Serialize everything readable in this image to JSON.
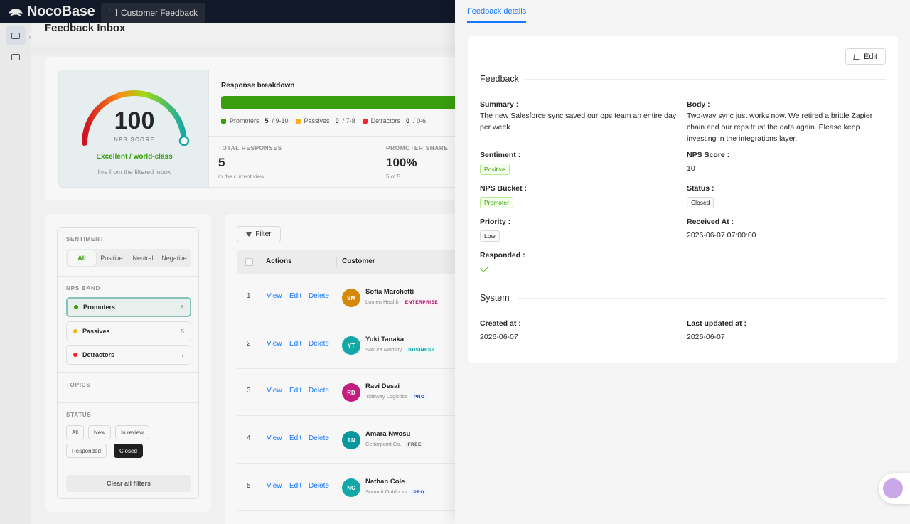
{
  "app": {
    "logo_text": "NocoBase",
    "tab_label": "Customer Feedback"
  },
  "page": {
    "title": "Feedback Inbox"
  },
  "nps": {
    "value": "100",
    "caption": "NPS SCORE",
    "grade": "Excellent / world-class",
    "note": "live from the filtered inbox",
    "gauge_fraction": 1.0
  },
  "breakdown": {
    "title": "Response breakdown",
    "legend": [
      {
        "label": "Promoters",
        "count": "5",
        "range": "/ 9-10",
        "color": "#389e0d"
      },
      {
        "label": "Passives",
        "count": "0",
        "range": "/ 7-8",
        "color": "#faad14"
      },
      {
        "label": "Detractors",
        "count": "0",
        "range": "/ 0-6",
        "color": "#f5222d"
      }
    ],
    "stats": [
      {
        "label": "TOTAL RESPONSES",
        "value": "5",
        "sub": "in the current view"
      },
      {
        "label": "PROMOTER SHARE",
        "value": "100%",
        "sub": "5 of 5"
      }
    ]
  },
  "filters": {
    "sentiment_label": "SENTIMENT",
    "sentiment": [
      "All",
      "Positive",
      "Neutral",
      "Negative"
    ],
    "nps_band_label": "NPS BAND",
    "bands": [
      {
        "label": "Promoters",
        "count": "8",
        "color": "#389e0d"
      },
      {
        "label": "Passives",
        "count": "5",
        "color": "#faad14"
      },
      {
        "label": "Detractors",
        "count": "7",
        "color": "#f5222d"
      }
    ],
    "topics_label": "TOPICS",
    "status_label": "STATUS",
    "status": [
      "All",
      "New",
      "In review",
      "Responded",
      "Closed"
    ],
    "clear_label": "Clear all filters"
  },
  "table": {
    "filter_label": "Filter",
    "headers": {
      "actions": "Actions",
      "customer": "Customer"
    },
    "actions": {
      "view": "View",
      "edit": "Edit",
      "delete": "Delete"
    },
    "rows": [
      {
        "idx": "1",
        "initials": "SM",
        "name": "Sofia Marchetti",
        "company": "Lumen Health",
        "tier": "ENTERPRISE",
        "avatar": "#d48806",
        "tier_color": "#9e1068",
        "tier_bg": "#fff0f6"
      },
      {
        "idx": "2",
        "initials": "YT",
        "name": "Yuki Tanaka",
        "company": "Sakura Mobility",
        "tier": "BUSINESS",
        "avatar": "#13a8a8",
        "tier_color": "#08979c",
        "tier_bg": "#e6fffb"
      },
      {
        "idx": "3",
        "initials": "RD",
        "name": "Ravi Desai",
        "company": "Tideway Logistics",
        "tier": "PRO",
        "avatar": "#c41d7f",
        "tier_color": "#1d39c4",
        "tier_bg": "#f0f5ff"
      },
      {
        "idx": "4",
        "initials": "AN",
        "name": "Amara Nwosu",
        "company": "Cedarpoint Co.",
        "tier": "FREE",
        "avatar": "#08979c",
        "tier_color": "#595959",
        "tier_bg": "#f5f5f5"
      },
      {
        "idx": "5",
        "initials": "NC",
        "name": "Nathan Cole",
        "company": "Summit Outdoors",
        "tier": "PRO",
        "avatar": "#13a8a8",
        "tier_color": "#1d39c4",
        "tier_bg": "#f0f5ff"
      }
    ]
  },
  "drawer": {
    "tab": "Feedback details",
    "edit_label": "Edit",
    "section_feedback": "Feedback",
    "section_system": "System",
    "fields": {
      "summary_label": "Summary :",
      "summary": "The new Salesforce sync saved our ops team an entire day per week",
      "body_label": "Body :",
      "body": "Two-way sync just works now. We retired a brittle Zapier chain and our reps trust the data again. Please keep investing in the integrations layer.",
      "sentiment_label": "Sentiment :",
      "sentiment": "Positive",
      "nps_score_label": "NPS Score :",
      "nps_score": "10",
      "nps_bucket_label": "NPS Bucket :",
      "nps_bucket": "Promoter",
      "status_label": "Status :",
      "status": "Closed",
      "priority_label": "Priority :",
      "priority": "Low",
      "received_label": "Received At :",
      "received": "2026-06-07 07:00:00",
      "responded_label": "Responded :",
      "created_label": "Created at :",
      "created": "2026-06-07",
      "updated_label": "Last updated at :",
      "updated": "2026-06-07"
    }
  }
}
